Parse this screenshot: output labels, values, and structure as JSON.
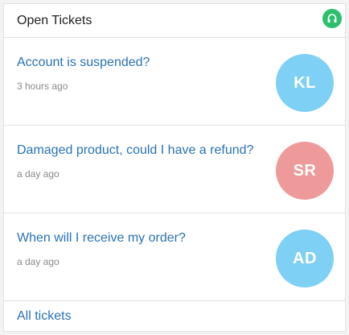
{
  "header": {
    "title": "Open Tickets",
    "badge_icon": "headset-icon",
    "badge_color": "#2ebf6e"
  },
  "tickets": [
    {
      "title": "Account is suspended?",
      "time": "3 hours ago",
      "initials": "KL",
      "avatar_color": "#7fd0f5"
    },
    {
      "title": "Damaged product, could I have a refund?",
      "time": "a day ago",
      "initials": "SR",
      "avatar_color": "#ee9a9a"
    },
    {
      "title": "When will I receive my order?",
      "time": "a day ago",
      "initials": "AD",
      "avatar_color": "#7fd0f5"
    }
  ],
  "footer": {
    "link_label": "All tickets"
  }
}
